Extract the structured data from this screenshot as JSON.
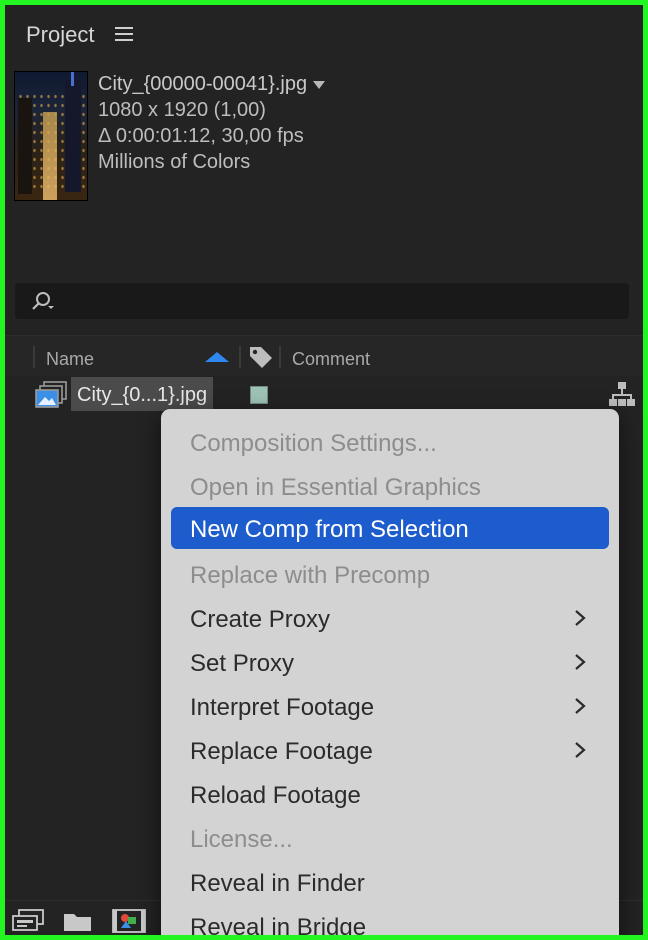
{
  "panel": {
    "title": "Project"
  },
  "footage_info": {
    "name": "City_{00000-00041}.jpg",
    "dimensions": "1080 x 1920 (1,00)",
    "duration": "Δ 0:00:01:12, 30,00 fps",
    "color_depth": "Millions of Colors"
  },
  "search": {
    "value": ""
  },
  "columns": {
    "name": "Name",
    "comment": "Comment"
  },
  "item": {
    "name": "City_{0...1}.jpg",
    "label_color": "#9fc2b6"
  },
  "context_menu": {
    "items": [
      {
        "label": "Composition Settings...",
        "enabled": false,
        "submenu": false
      },
      {
        "label": "Open in Essential Graphics",
        "enabled": false,
        "submenu": false
      },
      {
        "label": "New Comp from Selection",
        "enabled": true,
        "submenu": false,
        "highlighted": true
      },
      {
        "label": "Replace with Precomp",
        "enabled": false,
        "submenu": false
      },
      {
        "label": "Create Proxy",
        "enabled": true,
        "submenu": true
      },
      {
        "label": "Set Proxy",
        "enabled": true,
        "submenu": true
      },
      {
        "label": "Interpret Footage",
        "enabled": true,
        "submenu": true
      },
      {
        "label": "Replace Footage",
        "enabled": true,
        "submenu": true
      },
      {
        "label": "Reload Footage",
        "enabled": true,
        "submenu": false
      },
      {
        "label": "License...",
        "enabled": false,
        "submenu": false
      },
      {
        "label": "Reveal in Finder",
        "enabled": true,
        "submenu": false
      },
      {
        "label": "Reveal in Bridge",
        "enabled": true,
        "submenu": false
      }
    ]
  },
  "colors": {
    "accent": "#1d5ccc",
    "frame": "#22f51f",
    "sort_arrow": "#2f87f0"
  }
}
